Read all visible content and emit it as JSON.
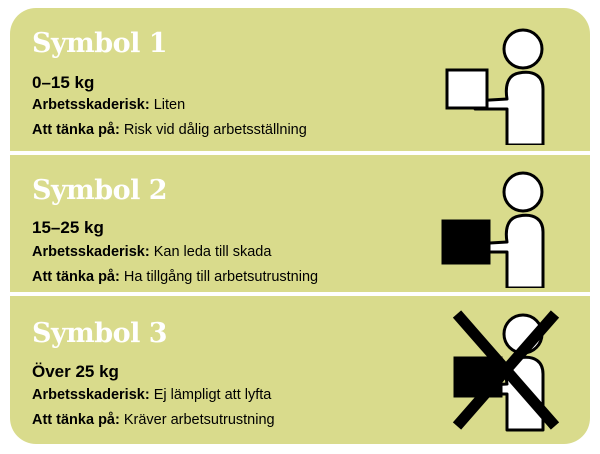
{
  "symbols": [
    {
      "title": "Symbol 1",
      "weight": "0–15 kg",
      "risk_label": "Arbetsskaderisk:",
      "risk_value": "Liten",
      "think_label": "Att tänka på:",
      "think_value": "Risk vid dålig arbetsställning",
      "icon": "person-carrying-light-box-icon"
    },
    {
      "title": "Symbol 2",
      "weight": "15–25 kg",
      "risk_label": "Arbetsskaderisk:",
      "risk_value": "Kan leda till skada",
      "think_label": "Att tänka på:",
      "think_value": "Ha tillgång till arbetsutrustning",
      "icon": "person-carrying-heavy-box-icon"
    },
    {
      "title": "Symbol 3",
      "weight": "Över 25 kg",
      "risk_label": "Arbetsskaderisk:",
      "risk_value": "Ej lämpligt att lyfta",
      "think_label": "Att tänka på:",
      "think_value": "Kräver arbetsutrustning",
      "icon": "person-carrying-box-crossed-out-icon"
    }
  ],
  "colors": {
    "panel": "#d9db8c",
    "title": "#ffffff",
    "text": "#000000"
  }
}
